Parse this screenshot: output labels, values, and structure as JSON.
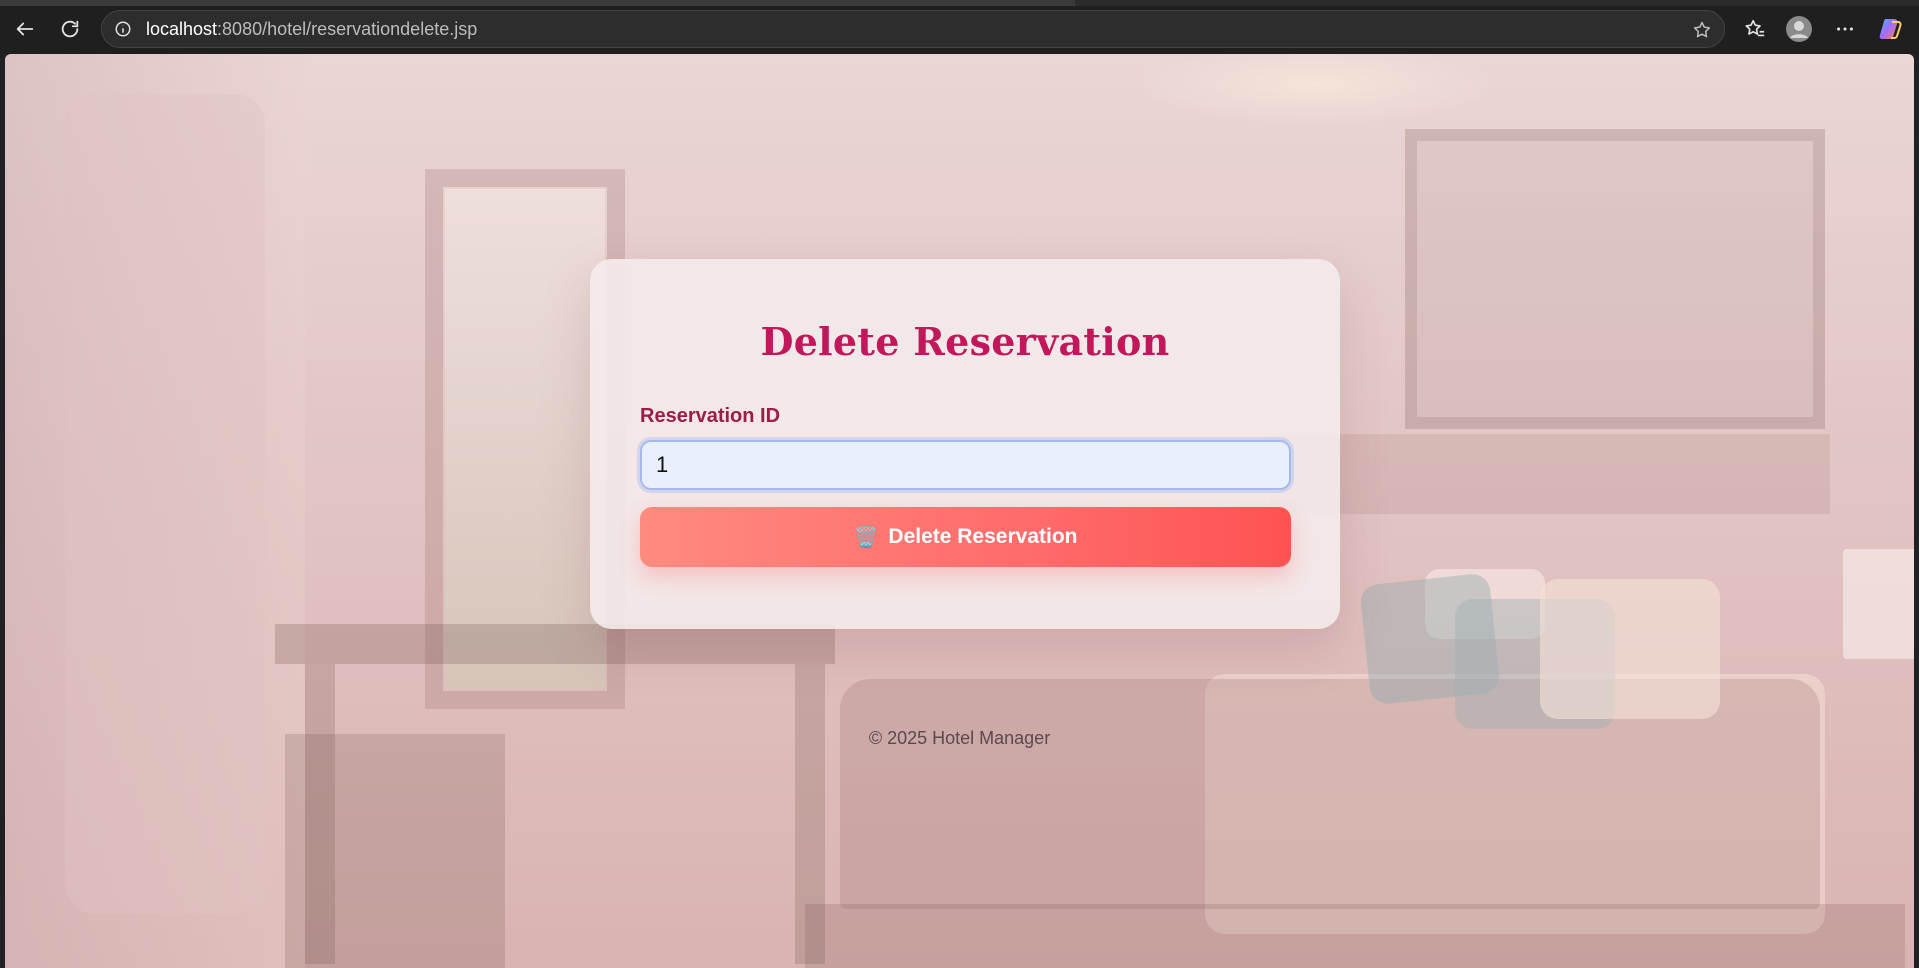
{
  "browser": {
    "url_host": "localhost",
    "url_path": ":8080/hotel/reservationdelete.jsp",
    "icons": {
      "back": "back-arrow-icon",
      "reload": "reload-icon",
      "site_info": "info-icon",
      "favorite": "star-icon",
      "favorites_bar": "favorites-icon",
      "profile": "profile-icon",
      "menu": "more-icon",
      "copilot": "copilot-icon"
    }
  },
  "page": {
    "title": "Delete Reservation",
    "form": {
      "reservation_id_label": "Reservation ID",
      "reservation_id_value": "1",
      "submit_icon": "🗑️",
      "submit_label": "Delete Reservation"
    },
    "footer": "© 2025 Hotel Manager"
  },
  "colors": {
    "title": "#c2185b",
    "label": "#9c1d4a",
    "button_start": "#ff8a80",
    "button_end": "#ff5252",
    "input_bg": "#e8f0fe"
  }
}
